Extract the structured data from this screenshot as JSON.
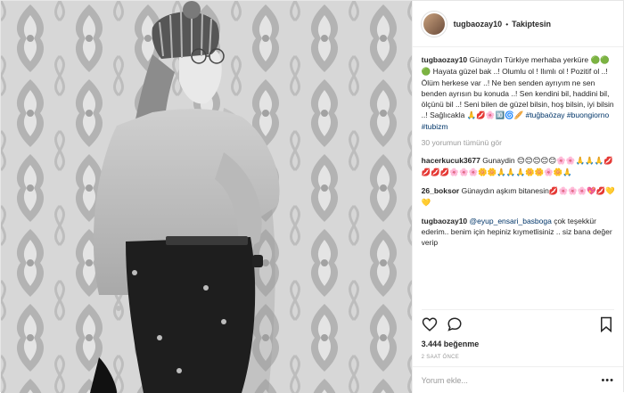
{
  "header": {
    "username": "tugbaozay10",
    "separator": "•",
    "follow_state": "Takiptesin"
  },
  "caption": {
    "username": "tugbaozay10",
    "text_part1": "Günaydın Türkiye merhaba yerküre ",
    "emoji1": "🟢🟢🟢",
    "text_part2": " Hayata güzel bak ..! Olumlu ol ! Ilımlı ol ! Pozitif ol ..! Ölüm herkese var ..! Ne ben senden ayrıyım ne sen benden ayrısın bu konuda ..! Sen kendini bil, haddini bil, ölçünü bil ..! Seni bilen de güzel bilsin, hoş bilsin, iyi bilsin ..! Sağlıcakla ",
    "emoji2": "🙏💋🌸🔟🌀🥖",
    "tags": [
      "#tuğbaözay",
      "#buongiorno",
      "#tubizm"
    ]
  },
  "view_all_comments": "30 yorumun tümünü gör",
  "comments": [
    {
      "username": "hacerkucuk3677",
      "text": "Gunaydin ",
      "emoji": "😊😊😊😊😊🌸🌸🙏🙏🙏💋💋💋💋🌸🌸🌸🌼🌼🙏🙏🙏🌼🌼🌸🌼🙏"
    },
    {
      "username": "26_boksor",
      "text": "Günaydın aşkım bitanesin",
      "emoji": "💋🌸🌸🌸💖💋💛💛"
    },
    {
      "username": "tugbaozay10",
      "mention": "@eyup_ensari_basboga",
      "text": " çok teşekkür ederim.. benim için hepiniz kıymetlisiniz .. siz bana değer verip"
    }
  ],
  "actions": {
    "likes": "3.444 beğenme",
    "time": "2 SAAT ÖNCE"
  },
  "add_comment": {
    "placeholder": "Yorum ekle...",
    "more": "•••"
  },
  "icons": [
    "heart-icon",
    "comment-icon",
    "bookmark-icon",
    "more-options-icon"
  ]
}
